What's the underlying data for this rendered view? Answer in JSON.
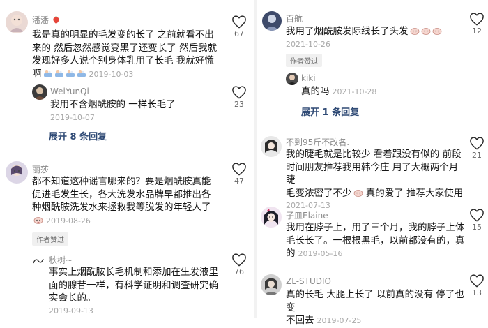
{
  "left": {
    "c1": {
      "name": "潘潘",
      "line1": "我是真的明显的毛发变的长了 之前就看不出",
      "line2": "来的 然后忽然感觉变黑了还变长了 然后我就",
      "line3": "发现好多人说个别身体乳用了长毛 我就好慌",
      "line4": "啊",
      "date": "2019-10-03",
      "likes": "67"
    },
    "c1r": {
      "name": "WeiYunQi",
      "text": "我用不含烟酰胺的 一样长毛了",
      "date": "2019-10-07",
      "likes": "23"
    },
    "c1e": "展开 8 条回复",
    "c2": {
      "name": "丽莎",
      "line1": "都不知道这种谣言哪来的？要是烟酰胺真能",
      "line2": "促进毛发生长，各大洗发水品牌早都推出各",
      "line3": "种烟酰胺洗发水来拯救我等脱发的年轻人了",
      "date": "2019-08-26",
      "likes": "47",
      "badge": "作者赞过"
    },
    "c2r": {
      "name": "秋树~",
      "line1": "事实上烟酰胺长毛机制和添加在生发液里",
      "line2": "面的腺苷一样，有科学证明和调查研究确",
      "line3": "实会长的。",
      "date": "2019-09-13",
      "likes": "76"
    }
  },
  "right": {
    "c1": {
      "name": "百航",
      "text": "我用了烟酰胺发际线长了头发",
      "date": "2021-10-26",
      "likes": "12",
      "badge": "作者赞过"
    },
    "c1r": {
      "name": "kiki",
      "text": "真的吗",
      "date": "2021-10-28"
    },
    "c1e": "展开 1 条回复",
    "c2": {
      "name": "不到95斤不改名.",
      "line1": "我的睫毛就是比较少 看着跟没有似的  前段",
      "line2": "时间朋友推荐我用韩今庄 用了大概两个月 睫",
      "line3": "毛变浓密了不少",
      "line3b": " 真的爱了 推荐大家使用",
      "date": "2021-07-13",
      "likes": "21"
    },
    "c3": {
      "name": "子皿Elaine",
      "line1": "我用在脖子上，用了三个月，我的脖子上体",
      "line2": "毛长长了。一根根黑毛，以前都没有的，真",
      "line3": "的",
      "date": "2019-05-16",
      "likes": "15"
    },
    "c4": {
      "name": "ZL-STUDIO",
      "line1": "真的长毛 大腿上长了 以前真的没有 停了也变",
      "line2": "不回去",
      "date": "2019-07-25",
      "likes": "13"
    }
  },
  "colors": {
    "link": "#2f4a75",
    "date": "#a8a8a8",
    "name": "#8a8a8a"
  }
}
